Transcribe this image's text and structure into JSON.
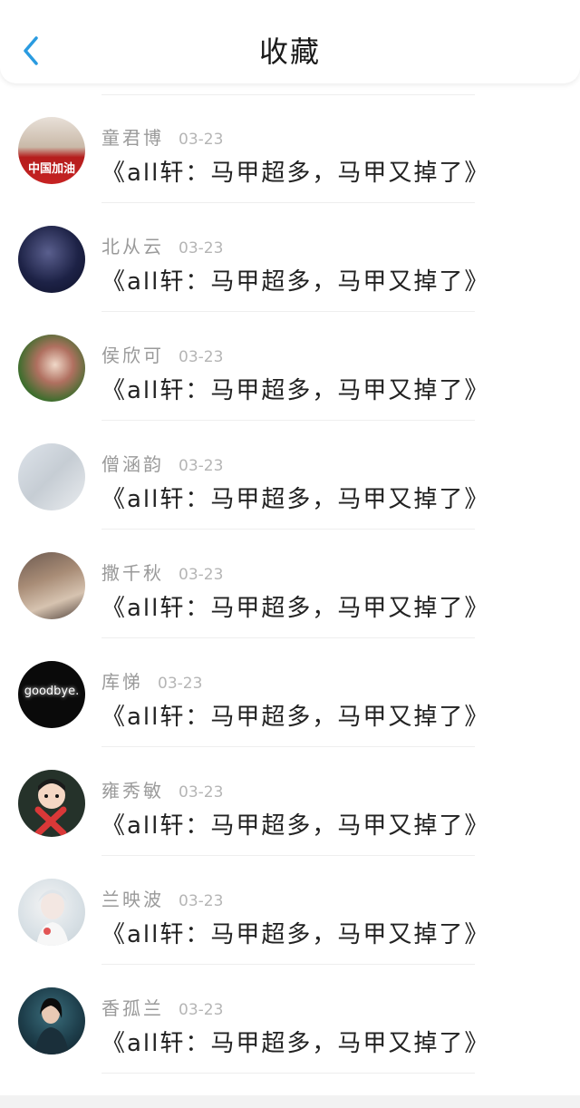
{
  "header": {
    "title": "收藏",
    "back_icon": "chevron-left-icon",
    "accent_color": "#2a9be0"
  },
  "items": [
    {
      "name": "童君博",
      "date": "03-23",
      "work": "《all轩：马甲超多，马甲又掉了》",
      "avatar_text": "中国加油"
    },
    {
      "name": "北从云",
      "date": "03-23",
      "work": "《all轩：马甲超多，马甲又掉了》"
    },
    {
      "name": "侯欣可",
      "date": "03-23",
      "work": "《all轩：马甲超多，马甲又掉了》"
    },
    {
      "name": "僧涵韵",
      "date": "03-23",
      "work": "《all轩：马甲超多，马甲又掉了》"
    },
    {
      "name": "撒千秋",
      "date": "03-23",
      "work": "《all轩：马甲超多，马甲又掉了》"
    },
    {
      "name": "库悌",
      "date": "03-23",
      "work": "《all轩：马甲超多，马甲又掉了》",
      "avatar_text": "goodbye."
    },
    {
      "name": "雍秀敏",
      "date": "03-23",
      "work": "《all轩：马甲超多，马甲又掉了》"
    },
    {
      "name": "兰映波",
      "date": "03-23",
      "work": "《all轩：马甲超多，马甲又掉了》"
    },
    {
      "name": "香孤兰",
      "date": "03-23",
      "work": "《all轩：马甲超多，马甲又掉了》"
    }
  ]
}
